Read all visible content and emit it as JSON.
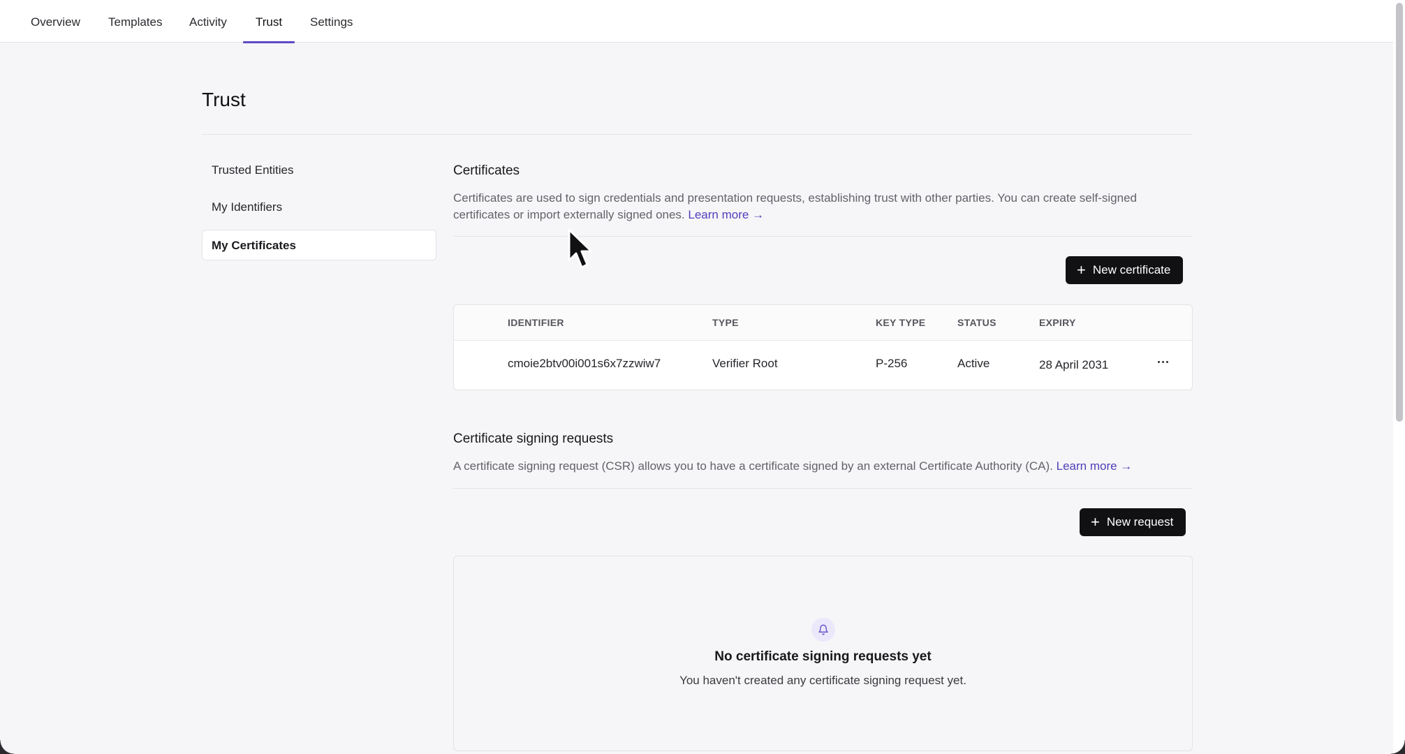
{
  "topnav": {
    "tabs": [
      {
        "label": "Overview"
      },
      {
        "label": "Templates"
      },
      {
        "label": "Activity"
      },
      {
        "label": "Trust",
        "active": true
      },
      {
        "label": "Settings"
      }
    ]
  },
  "page": {
    "title": "Trust"
  },
  "sidebar": {
    "items": [
      {
        "label": "Trusted Entities"
      },
      {
        "label": "My Identifiers"
      },
      {
        "label": "My Certificates",
        "active": true
      }
    ]
  },
  "certificates": {
    "title": "Certificates",
    "description": "Certificates are used to sign credentials and presentation requests, establishing trust with other parties. You can create self-signed certificates or import externally signed ones.",
    "learn_more": "Learn more →",
    "new_button": "New certificate",
    "columns": [
      "IDENTIFIER",
      "TYPE",
      "KEY TYPE",
      "STATUS",
      "EXPIRY"
    ],
    "rows": [
      {
        "identifier": "cmoie2btv00i001s6x7zzwiw7",
        "type": "Verifier Root",
        "key_type": "P-256",
        "status": "Active",
        "expiry": "28 April 2031"
      }
    ]
  },
  "csr": {
    "title": "Certificate signing requests",
    "description": "A certificate signing request (CSR) allows you to have a certificate signed by an external Certificate Authority (CA).",
    "learn_more": "Learn more →",
    "new_button": "New request",
    "empty_title": "No certificate signing requests yet",
    "empty_subtitle": "You haven't created any certificate signing request yet."
  },
  "colors": {
    "accent": "#5b4bc4",
    "link": "#4f3fb8",
    "button_bg": "#111114",
    "page_bg": "#f6f6f8"
  },
  "icons": {
    "plus": "plus-icon",
    "bell": "bell-icon",
    "more": "more-horizontal-icon",
    "cursor": "mouse-pointer-icon"
  }
}
